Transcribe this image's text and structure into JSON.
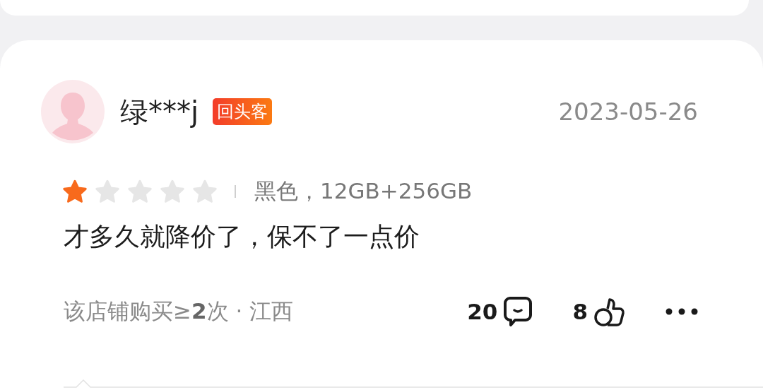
{
  "review": {
    "user": "绿***j",
    "badge": "回头客",
    "date": "2023-05-26",
    "stars": 1,
    "variant": "黑色，12GB+256GB",
    "text": "才多久就降价了，保不了一点价",
    "purchase_info": "该店铺购买≥**2**次 · 江西",
    "comments": "20",
    "likes": "8"
  }
}
